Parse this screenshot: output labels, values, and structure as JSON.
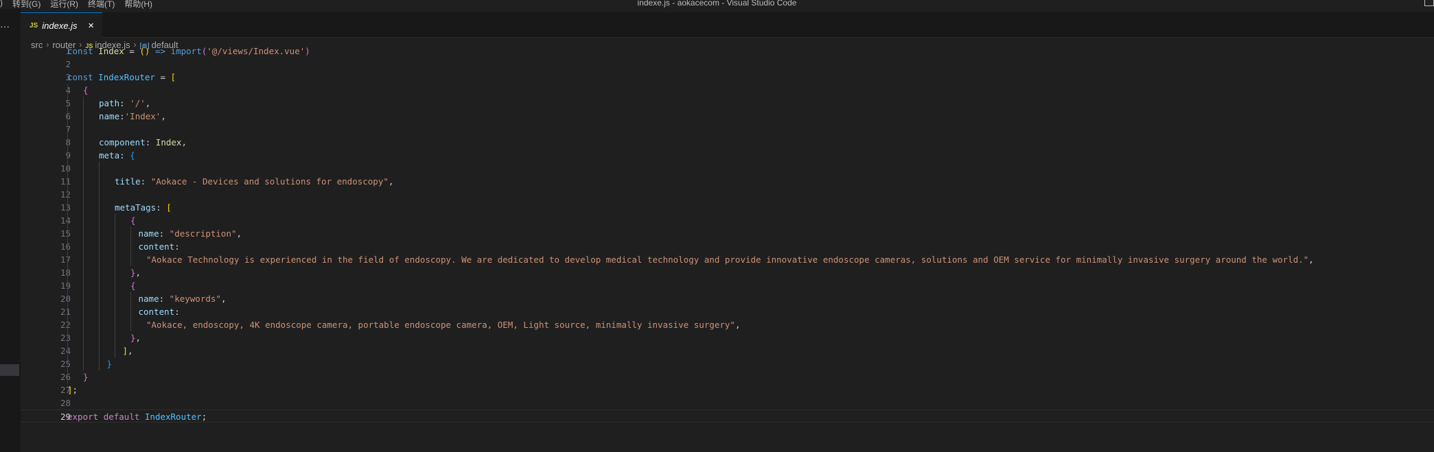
{
  "window": {
    "title": "indexe.js - aokacecom - Visual Studio Code",
    "menu": [
      ")",
      "转到(G)",
      "运行(R)",
      "终端(T)",
      "帮助(H)"
    ]
  },
  "activity_bar": {
    "more_label": "···"
  },
  "tab": {
    "icon_label": "JS",
    "name": "indexe.js",
    "close_label": "×"
  },
  "breadcrumb": {
    "items": [
      "src",
      "router",
      "indexe.js",
      "default"
    ],
    "file_icon_label": "JS",
    "symbol_icon_label": "[⊚]"
  },
  "editor": {
    "current_line": 29,
    "lines": [
      {
        "n": 1,
        "indent": 0,
        "tokens": [
          [
            "kw",
            "const"
          ],
          [
            "txt",
            " "
          ],
          [
            "fn",
            "Index"
          ],
          [
            "txt",
            " = "
          ],
          [
            "b1",
            "()"
          ],
          [
            "txt",
            " "
          ],
          [
            "kw",
            "=>"
          ],
          [
            "txt",
            " "
          ],
          [
            "kw",
            "import"
          ],
          [
            "b2",
            "("
          ],
          [
            "str",
            "'@/views/Index.vue'"
          ],
          [
            "b2",
            ")"
          ]
        ]
      },
      {
        "n": 2,
        "indent": 0,
        "tokens": []
      },
      {
        "n": 3,
        "indent": 0,
        "tokens": [
          [
            "kw",
            "const"
          ],
          [
            "txt",
            " "
          ],
          [
            "var",
            "IndexRouter"
          ],
          [
            "txt",
            " = "
          ],
          [
            "b1",
            "["
          ]
        ]
      },
      {
        "n": 4,
        "indent": 1,
        "tokens": [
          [
            "b2",
            "{"
          ]
        ]
      },
      {
        "n": 5,
        "indent": 2,
        "tokens": [
          [
            "prop",
            "path"
          ],
          [
            "txt",
            ": "
          ],
          [
            "str",
            "'/'"
          ],
          [
            "txt",
            ","
          ]
        ]
      },
      {
        "n": 6,
        "indent": 2,
        "tokens": [
          [
            "prop",
            "name"
          ],
          [
            "txt",
            ":"
          ],
          [
            "str",
            "'Index'"
          ],
          [
            "txt",
            ","
          ]
        ]
      },
      {
        "n": 7,
        "indent": 0,
        "guides": 2,
        "tokens": []
      },
      {
        "n": 8,
        "indent": 2,
        "tokens": [
          [
            "prop",
            "component"
          ],
          [
            "txt",
            ": "
          ],
          [
            "fn",
            "Index"
          ],
          [
            "txt",
            ","
          ]
        ]
      },
      {
        "n": 9,
        "indent": 2,
        "tokens": [
          [
            "prop",
            "meta"
          ],
          [
            "txt",
            ": "
          ],
          [
            "b3",
            "{"
          ]
        ]
      },
      {
        "n": 10,
        "indent": 0,
        "guides": 3,
        "tokens": []
      },
      {
        "n": 11,
        "indent": 3,
        "tokens": [
          [
            "prop",
            "title"
          ],
          [
            "txt",
            ": "
          ],
          [
            "str",
            "\"Aokace - Devices and solutions for endoscopy\""
          ],
          [
            "txt",
            ","
          ]
        ]
      },
      {
        "n": 12,
        "indent": 0,
        "guides": 3,
        "tokens": []
      },
      {
        "n": 13,
        "indent": 3,
        "tokens": [
          [
            "prop",
            "metaTags"
          ],
          [
            "txt",
            ": "
          ],
          [
            "b1",
            "["
          ]
        ]
      },
      {
        "n": 14,
        "indent": 4,
        "tokens": [
          [
            "b2",
            "{"
          ]
        ]
      },
      {
        "n": 15,
        "indent": 4.5,
        "tokens": [
          [
            "prop",
            "name"
          ],
          [
            "txt",
            ": "
          ],
          [
            "str",
            "\"description\""
          ],
          [
            "txt",
            ","
          ]
        ]
      },
      {
        "n": 16,
        "indent": 4.5,
        "tokens": [
          [
            "prop",
            "content"
          ],
          [
            "txt",
            ":"
          ]
        ]
      },
      {
        "n": 17,
        "indent": 5,
        "tokens": [
          [
            "str",
            "\"Aokace Technology is experienced in the field of endoscopy. We are dedicated to develop medical technology and provide innovative endoscope cameras, solutions and OEM service for minimally invasive surgery around the world.\""
          ],
          [
            "txt",
            ","
          ]
        ]
      },
      {
        "n": 18,
        "indent": 4,
        "tokens": [
          [
            "b2",
            "}"
          ],
          [
            "txt",
            ","
          ]
        ]
      },
      {
        "n": 19,
        "indent": 4,
        "tokens": [
          [
            "b2",
            "{"
          ]
        ]
      },
      {
        "n": 20,
        "indent": 4.5,
        "tokens": [
          [
            "prop",
            "name"
          ],
          [
            "txt",
            ": "
          ],
          [
            "str",
            "\"keywords\""
          ],
          [
            "txt",
            ","
          ]
        ]
      },
      {
        "n": 21,
        "indent": 4.5,
        "tokens": [
          [
            "prop",
            "content"
          ],
          [
            "txt",
            ":"
          ]
        ]
      },
      {
        "n": 22,
        "indent": 5,
        "tokens": [
          [
            "str",
            "\"Aokace, endoscopy, 4K endoscope camera, portable endoscope camera, OEM, Light source, minimally invasive surgery\""
          ],
          [
            "txt",
            ","
          ]
        ]
      },
      {
        "n": 23,
        "indent": 4,
        "tokens": [
          [
            "b2",
            "}"
          ],
          [
            "txt",
            ","
          ]
        ]
      },
      {
        "n": 24,
        "indent": 3.5,
        "tokens": [
          [
            "b1",
            "]"
          ],
          [
            "txt",
            ","
          ]
        ]
      },
      {
        "n": 25,
        "indent": 2.5,
        "tokens": [
          [
            "b3",
            "}"
          ]
        ]
      },
      {
        "n": 26,
        "indent": 1,
        "tokens": [
          [
            "b2",
            "}"
          ]
        ]
      },
      {
        "n": 27,
        "indent": 0,
        "tokens": [
          [
            "b1",
            "]"
          ],
          [
            "txt",
            ";"
          ]
        ]
      },
      {
        "n": 28,
        "indent": 0,
        "tokens": []
      },
      {
        "n": 29,
        "indent": 0,
        "tokens": [
          [
            "ctl",
            "export"
          ],
          [
            "txt",
            " "
          ],
          [
            "ctl",
            "default"
          ],
          [
            "txt",
            " "
          ],
          [
            "var",
            "IndexRouter"
          ],
          [
            "txt",
            ";"
          ]
        ]
      }
    ]
  }
}
